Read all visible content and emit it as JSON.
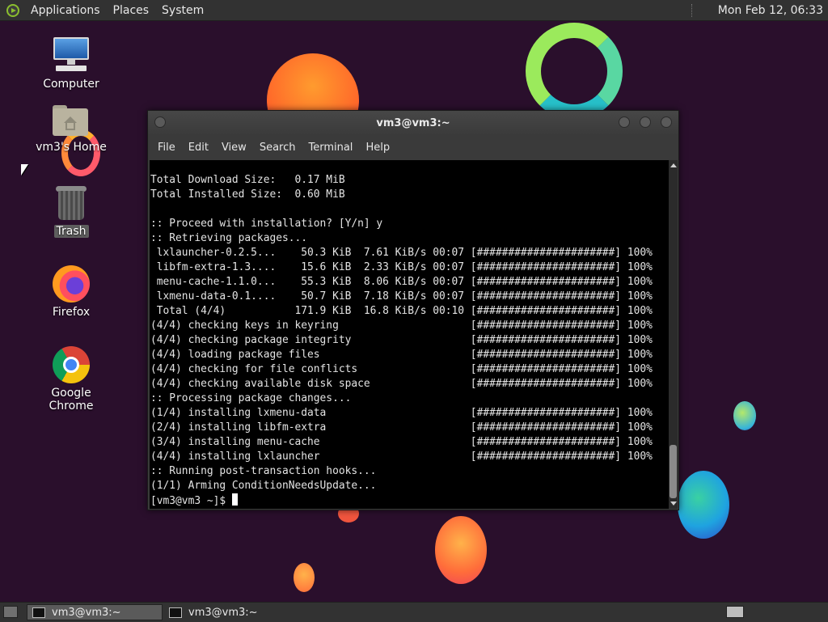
{
  "top_panel": {
    "menus": [
      "Applications",
      "Places",
      "System"
    ],
    "clock": "Mon Feb 12, 06:33"
  },
  "desktop_icons": [
    {
      "label": "Computer",
      "icon": "computer-icon"
    },
    {
      "label": "vm3's Home",
      "icon": "home-folder-icon"
    },
    {
      "label": "Trash",
      "icon": "trash-icon"
    },
    {
      "label": "Firefox",
      "icon": "firefox-icon"
    },
    {
      "label": "Google Chrome",
      "icon": "chrome-icon"
    }
  ],
  "terminal": {
    "title": "vm3@vm3:~",
    "menu": [
      "File",
      "Edit",
      "View",
      "Search",
      "Terminal",
      "Help"
    ],
    "lines": [
      "Total Download Size:   0.17 MiB",
      "Total Installed Size:  0.60 MiB",
      "",
      ":: Proceed with installation? [Y/n] y",
      ":: Retrieving packages...",
      " lxlauncher-0.2.5...    50.3 KiB  7.61 KiB/s 00:07 [######################] 100%",
      " libfm-extra-1.3....    15.6 KiB  2.33 KiB/s 00:07 [######################] 100%",
      " menu-cache-1.1.0...    55.3 KiB  8.06 KiB/s 00:07 [######################] 100%",
      " lxmenu-data-0.1....    50.7 KiB  7.18 KiB/s 00:07 [######################] 100%",
      " Total (4/4)           171.9 KiB  16.8 KiB/s 00:10 [######################] 100%",
      "(4/4) checking keys in keyring                     [######################] 100%",
      "(4/4) checking package integrity                   [######################] 100%",
      "(4/4) loading package files                        [######################] 100%",
      "(4/4) checking for file conflicts                  [######################] 100%",
      "(4/4) checking available disk space                [######################] 100%",
      ":: Processing package changes...",
      "(1/4) installing lxmenu-data                       [######################] 100%",
      "(2/4) installing libfm-extra                       [######################] 100%",
      "(3/4) installing menu-cache                        [######################] 100%",
      "(4/4) installing lxlauncher                        [######################] 100%",
      ":: Running post-transaction hooks...",
      "(1/1) Arming ConditionNeedsUpdate..."
    ],
    "prompt": "[vm3@vm3 ~]$ "
  },
  "taskbar": {
    "tasks": [
      "vm3@vm3:~",
      "vm3@vm3:~"
    ]
  }
}
